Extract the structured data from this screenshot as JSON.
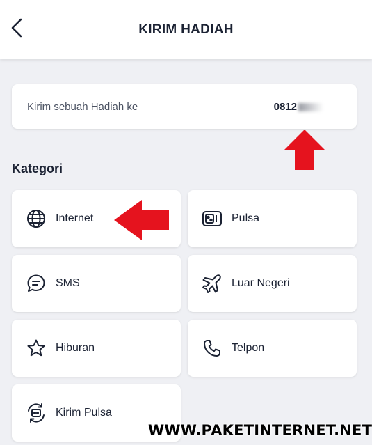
{
  "header": {
    "title": "KIRIM HADIAH",
    "back_icon": "chevron-left-icon"
  },
  "recipient": {
    "label": "Kirim sebuah Hadiah ke",
    "number_visible": "0812"
  },
  "categories_section": {
    "title": "Kategori",
    "items": [
      {
        "label": "Internet",
        "icon": "globe-icon"
      },
      {
        "label": "Pulsa",
        "icon": "sim-card-icon"
      },
      {
        "label": "SMS",
        "icon": "chat-bubble-icon"
      },
      {
        "label": "Luar Negeri",
        "icon": "airplane-icon"
      },
      {
        "label": "Hiburan",
        "icon": "star-icon"
      },
      {
        "label": "Telpon",
        "icon": "phone-icon"
      },
      {
        "label": "Kirim Pulsa",
        "icon": "send-pulsa-icon"
      }
    ]
  },
  "annotations": {
    "arrow_color": "#e5131e",
    "arrow_up_icon": "red-arrow-up-icon",
    "arrow_left_icon": "red-arrow-left-icon"
  },
  "watermark": "WWW.PAKETINTERNET.NET",
  "colors": {
    "text_primary": "#1b2233",
    "background": "#eff0f4",
    "card": "#ffffff"
  }
}
